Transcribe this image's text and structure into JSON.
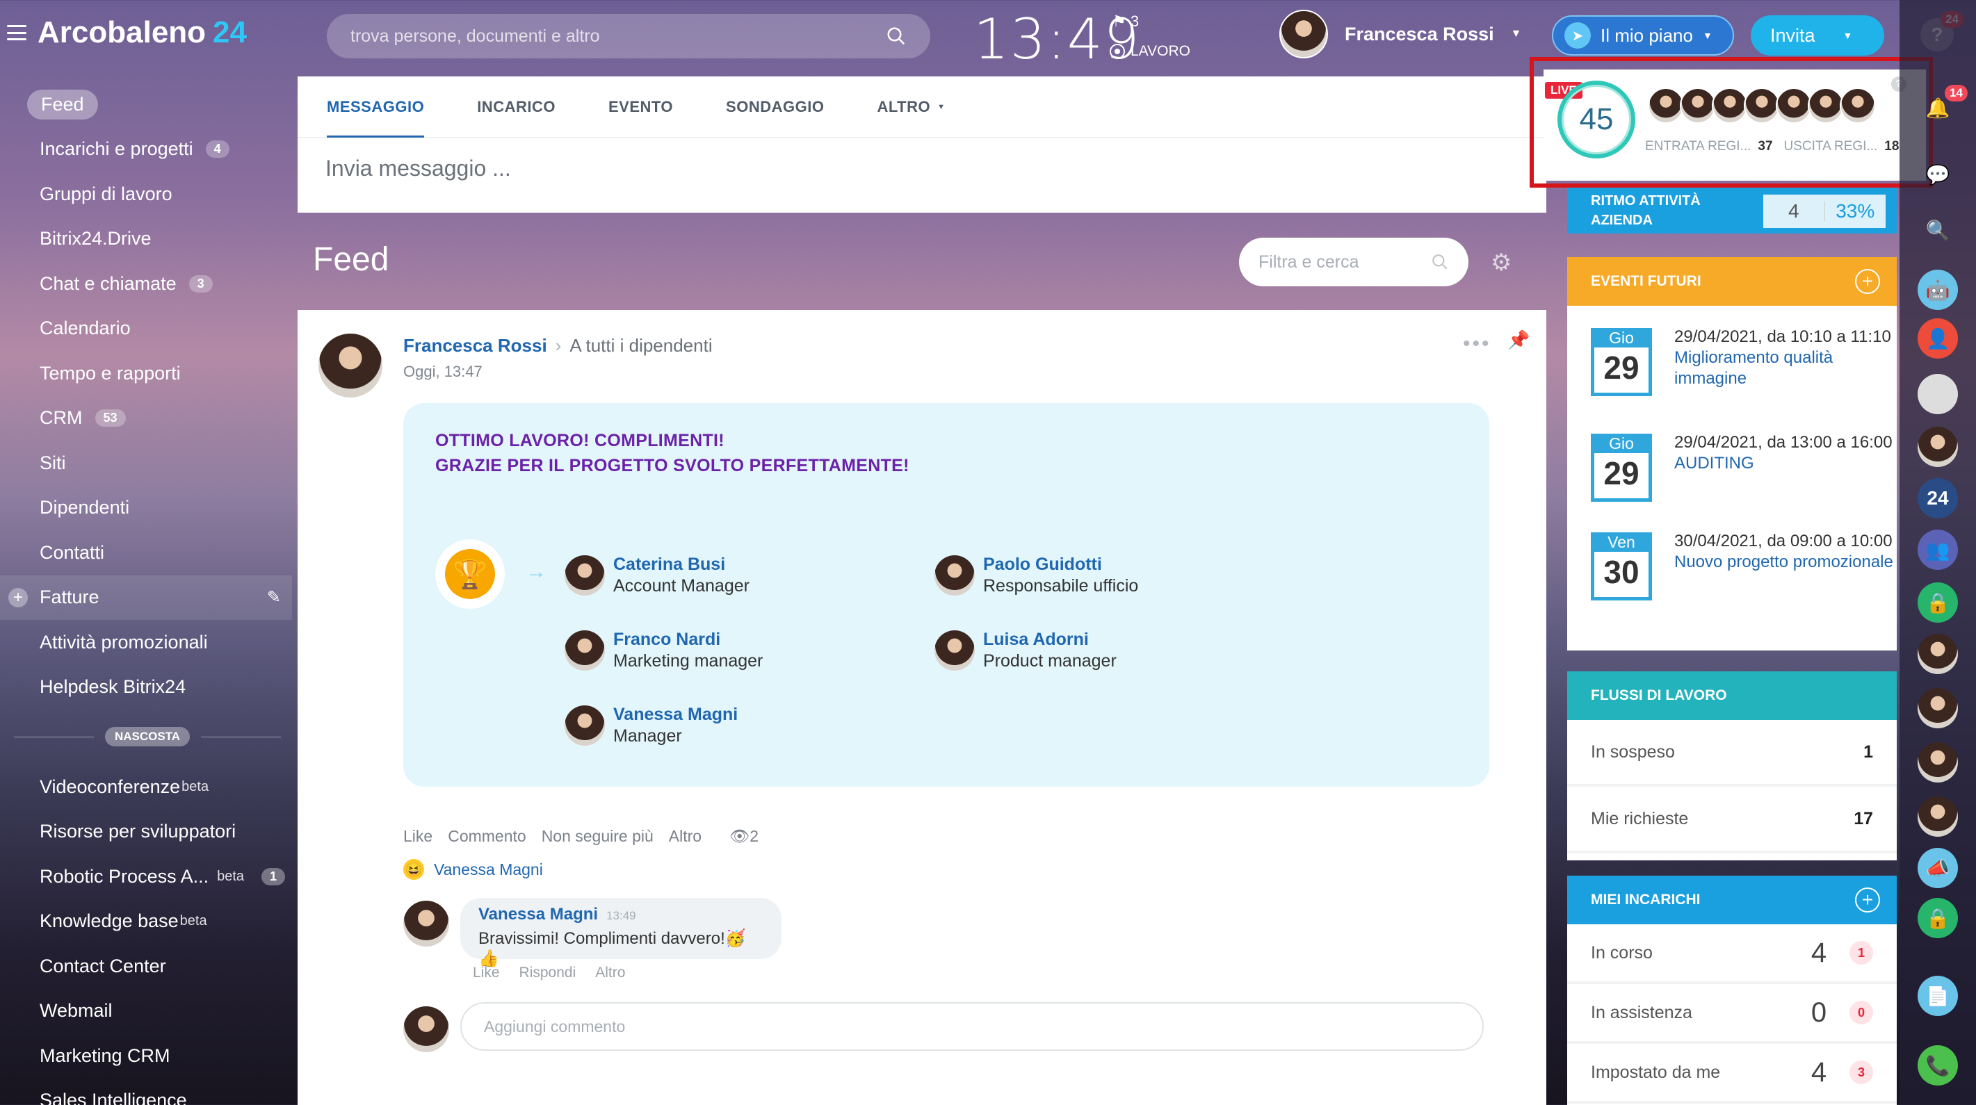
{
  "header": {
    "logo_name": "Arcobaleno",
    "logo_num": "24",
    "search_placeholder": "trova persone, documenti e altro",
    "clock": "13:49",
    "flag_count": "3",
    "work_status": "LAVORO",
    "user_name": "Francesca Rossi",
    "plan_label": "Il mio piano",
    "invite_label": "Invita",
    "help_badge": "24",
    "notif_badge": "14"
  },
  "sidebar": {
    "items": [
      {
        "label": "Feed"
      },
      {
        "label": "Incarichi e progetti",
        "count": "4"
      },
      {
        "label": "Gruppi di lavoro"
      },
      {
        "label": "Bitrix24.Drive"
      },
      {
        "label": "Chat e chiamate",
        "count": "3"
      },
      {
        "label": "Calendario"
      },
      {
        "label": "Tempo e rapporti"
      },
      {
        "label": "CRM",
        "count": "53"
      },
      {
        "label": "Siti"
      },
      {
        "label": "Dipendenti"
      },
      {
        "label": "Contatti"
      },
      {
        "label": "Fatture"
      },
      {
        "label": "Attività promozionali"
      },
      {
        "label": "Helpdesk Bitrix24"
      }
    ],
    "hidden_label": "NASCOSTA",
    "hidden_items": [
      {
        "label": "Videoconferenze",
        "sup": "beta"
      },
      {
        "label": "Risorse per sviluppatori"
      },
      {
        "label": "Robotic Process A...",
        "sup": "beta",
        "count": "1"
      },
      {
        "label": "Knowledge base",
        "sup": "beta"
      },
      {
        "label": "Contact Center"
      },
      {
        "label": "Webmail"
      },
      {
        "label": "Marketing CRM"
      },
      {
        "label": "Sales Intelligence"
      }
    ]
  },
  "composer": {
    "tabs": [
      "MESSAGGIO",
      "INCARICO",
      "EVENTO",
      "SONDAGGIO",
      "ALTRO"
    ],
    "placeholder": "Invia messaggio ..."
  },
  "feed": {
    "title": "Feed",
    "filter_placeholder": "Filtra e cerca"
  },
  "post": {
    "author": "Francesca Rossi",
    "audience": "A tutti i dipendenti",
    "time": "Oggi, 13:47",
    "title1": "OTTIMO LAVORO! COMPLIMENTI!",
    "title2": "GRAZIE PER IL PROGETTO SVOLTO PERFETTAMENTE!",
    "people": [
      {
        "name": "Caterina Busi",
        "role": "Account Manager"
      },
      {
        "name": "Paolo Guidotti",
        "role": "Responsabile ufficio"
      },
      {
        "name": "Franco Nardi",
        "role": "Marketing manager"
      },
      {
        "name": "Luisa Adorni",
        "role": "Product manager"
      },
      {
        "name": "Vanessa Magni",
        "role": "Manager"
      }
    ],
    "actions": [
      "Like",
      "Commento",
      "Non seguire più",
      "Altro"
    ],
    "views": "2",
    "reaction_user": "Vanessa Magni",
    "comment": {
      "author": "Vanessa Magni",
      "time": "13:49",
      "text": "Bravissimi! Complimenti davvero!🥳 👍",
      "actions": [
        "Like",
        "Rispondi",
        "Altro"
      ]
    },
    "add_comment_placeholder": "Aggiungi commento"
  },
  "live": {
    "tag": "LIVE",
    "value": "45",
    "in_label": "ENTRATA REGI...",
    "in_count": "37",
    "out_label": "USCITA REGI...",
    "out_count": "18"
  },
  "ritmo": {
    "label1": "RITMO ATTIVITÀ",
    "label2": "AZIENDA",
    "value": "4",
    "percent": "33%"
  },
  "events": {
    "title": "EVENTI FUTURI",
    "items": [
      {
        "day": "Gio",
        "num": "29",
        "time": "29/04/2021, da 10:10 a 11:10",
        "title": "Miglioramento qualità immagine"
      },
      {
        "day": "Gio",
        "num": "29",
        "time": "29/04/2021, da 13:00 a 16:00",
        "title": "AUDITING"
      },
      {
        "day": "Ven",
        "num": "30",
        "time": "30/04/2021, da 09:00 a 10:00",
        "title": "Nuovo progetto promozionale"
      }
    ]
  },
  "flussi": {
    "title": "FLUSSI DI LAVORO",
    "rows": [
      {
        "label": "In sospeso",
        "value": "1"
      },
      {
        "label": "Mie richieste",
        "value": "17"
      }
    ]
  },
  "incarichi": {
    "title": "MIEI INCARICHI",
    "rows": [
      {
        "label": "In corso",
        "value": "4",
        "badge": "1"
      },
      {
        "label": "In assistenza",
        "value": "0",
        "badge": "0"
      },
      {
        "label": "Impostato da me",
        "value": "4",
        "badge": "3"
      }
    ]
  },
  "colors": {
    "accent_blue": "#2067b0",
    "events_header": "#f7a928",
    "flussi_header": "#23b3bd",
    "incarichi_header": "#1aa0df",
    "highlight_red": "#d8141b"
  }
}
